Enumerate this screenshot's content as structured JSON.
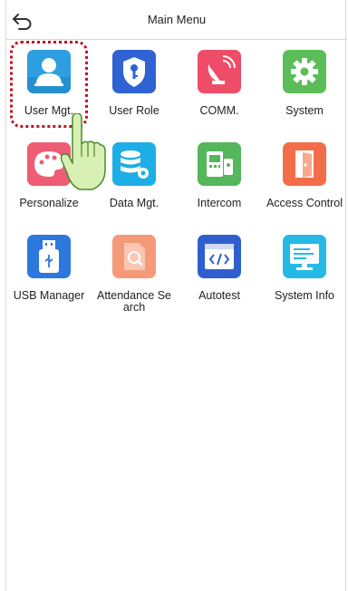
{
  "header": {
    "title": "Main Menu",
    "back_icon": "back-arrow-icon"
  },
  "colors": {
    "user_mgt": "#2d9fe0",
    "user_role": "#2f63d4",
    "comm": "#ef4d67",
    "system": "#5bbd58",
    "personalize": "#ee5d74",
    "data_mgt": "#1eaee6",
    "intercom": "#55b65b",
    "access_control": "#f26e49",
    "usb_manager": "#2d78dc",
    "attendance_search": "#f59a79",
    "autotest": "#2f5fcf",
    "system_info": "#25b9e6",
    "highlight": "#c0131f",
    "hand": "#d8f0b4"
  },
  "menu": {
    "items": [
      {
        "label": "User Mgt.",
        "icon": "user-icon"
      },
      {
        "label": "User Role",
        "icon": "shield-key-icon"
      },
      {
        "label": "COMM.",
        "icon": "satellite-dish-icon"
      },
      {
        "label": "System",
        "icon": "gear-icon"
      },
      {
        "label": "Personalize",
        "icon": "palette-icon"
      },
      {
        "label": "Data Mgt.",
        "icon": "database-gear-icon"
      },
      {
        "label": "Intercom",
        "icon": "intercom-phone-icon"
      },
      {
        "label": "Access Control",
        "icon": "door-icon"
      },
      {
        "label": "USB Manager",
        "icon": "usb-icon"
      },
      {
        "label": "Attendance Search",
        "icon": "search-document-icon"
      },
      {
        "label": "Autotest",
        "icon": "code-window-icon"
      },
      {
        "label": "System Info",
        "icon": "monitor-icon"
      }
    ]
  },
  "overlay": {
    "pointer_icon": "pointing-hand-icon"
  }
}
